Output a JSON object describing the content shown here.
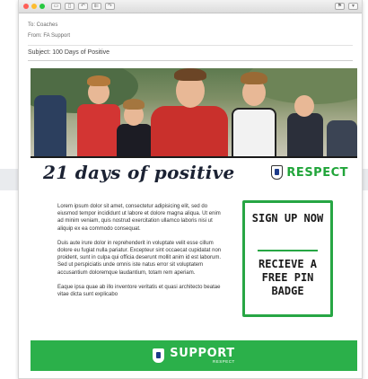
{
  "window": {
    "traffic_lights": [
      "#ff5f57",
      "#febc2e",
      "#28c840"
    ],
    "toolbar_icons": [
      "archive-icon",
      "trash-icon",
      "reply-icon",
      "reply-all-icon",
      "forward-icon"
    ]
  },
  "email": {
    "to": "To: Coaches",
    "from": "From: FA Support",
    "subject": "Subject: 100 Days of Positive"
  },
  "banner": {
    "title": "21 days of positive",
    "logo_text": "RESPECT"
  },
  "body": {
    "paragraph1": "Lorem ipsum dolor sit amet, consectetur adipisicing elit, sed do eiusmod tempor incididunt ut labore et dolore magna aliqua. Ut enim ad minim veniam, quis nostrud exercitation ullamco laboris nisi ut aliquip ex ea commodo consequat.",
    "paragraph2": "Duis aute irure dolor in reprehenderit in voluptate velit esse cillum dolore eu fugiat nulla pariatur. Excepteur sint occaecat cupidatat non proident, sunt in culpa qui officia deserunt mollit anim id est laborum. Sed ut perspiciatis unde omnis iste natus error sit voluptatem accusantium doloremque laudantium, totam rem aperiam.",
    "paragraph3": "Eaque ipsa quae ab illo inventore veritatis et quasi architecto beatae vitae dicta sunt explicabo"
  },
  "cta": {
    "line1": "SIGN UP NOW",
    "line2": "RECIEVE A FREE PIN BADGE"
  },
  "footer": {
    "logo_text": "SUPPORT",
    "logo_sub": "RESPECT"
  },
  "colors": {
    "brand_green": "#27a644",
    "footer_green": "#2bb04a",
    "title_navy": "#1b2233"
  }
}
